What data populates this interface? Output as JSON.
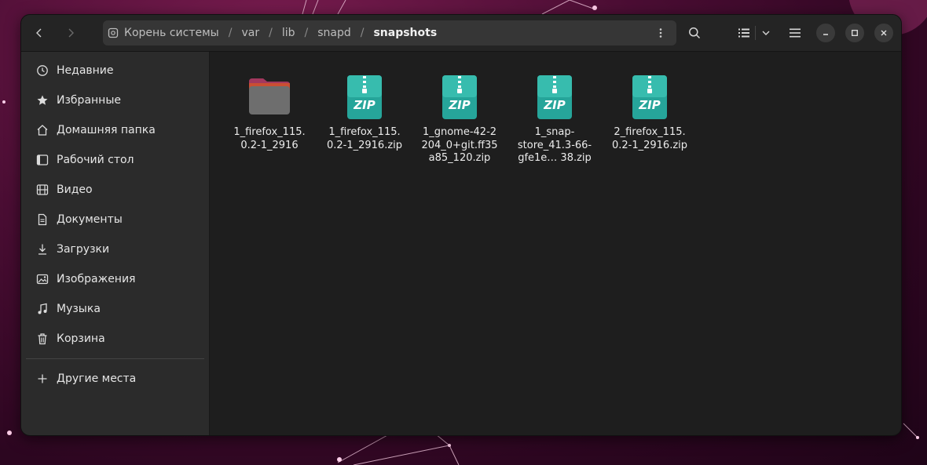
{
  "theme": {
    "accent": "#e95420",
    "folder": "#6e6e6e",
    "folder_tab": "#a3385e",
    "zip": "#26a59a"
  },
  "header": {
    "back_icon": "chevron-left-icon",
    "forward_icon": "chevron-right-icon",
    "breadcrumbs": [
      {
        "label": "Корень системы",
        "icon": "drive-icon"
      },
      {
        "label": "var"
      },
      {
        "label": "lib"
      },
      {
        "label": "snapd"
      },
      {
        "label": "snapshots",
        "current": true
      }
    ],
    "separator": "/",
    "path_menu_icon": "kebab-icon",
    "search_icon": "search-icon",
    "view_icon": "list-view-icon",
    "view_dropdown_icon": "chevron-down-icon",
    "menu_icon": "hamburger-icon",
    "window_controls": [
      "minimize-icon",
      "maximize-icon",
      "close-icon"
    ]
  },
  "sidebar": {
    "items": [
      {
        "label": "Недавние",
        "icon": "clock-icon"
      },
      {
        "label": "Избранные",
        "icon": "star-icon"
      },
      {
        "label": "Домашняя папка",
        "icon": "home-icon"
      },
      {
        "label": "Рабочий стол",
        "icon": "desktop-icon"
      },
      {
        "label": "Видео",
        "icon": "film-icon"
      },
      {
        "label": "Документы",
        "icon": "document-icon"
      },
      {
        "label": "Загрузки",
        "icon": "download-icon"
      },
      {
        "label": "Изображения",
        "icon": "image-icon"
      },
      {
        "label": "Музыка",
        "icon": "music-icon"
      },
      {
        "label": "Корзина",
        "icon": "trash-icon"
      }
    ],
    "other": {
      "label": "Другие места",
      "icon": "plus-icon"
    }
  },
  "files": [
    {
      "type": "folder",
      "line1": "1_firefox_115.",
      "line2": "0.2-1_2916",
      "line3": ""
    },
    {
      "type": "zip",
      "badge": "ZIP",
      "line1": "1_firefox_115.",
      "line2": "0.2-1_2916.zip",
      "line3": ""
    },
    {
      "type": "zip",
      "badge": "ZIP",
      "line1": "1_gnome-42-2",
      "line2": "204_0+git.ff35",
      "line3": "a85_120.zip"
    },
    {
      "type": "zip",
      "badge": "ZIP",
      "line1": "1_snap-",
      "line2": "store_41.3-66-",
      "line3": "gfe1e…  38.zip"
    },
    {
      "type": "zip",
      "badge": "ZIP",
      "line1": "2_firefox_115.",
      "line2": "0.2-1_2916.zip",
      "line3": ""
    }
  ]
}
